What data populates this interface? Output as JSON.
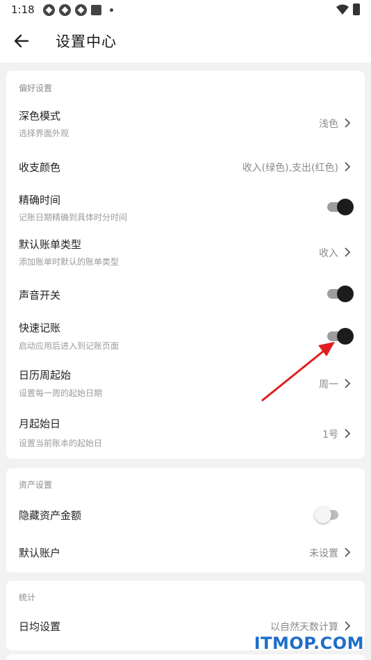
{
  "status_bar": {
    "time": "1:18"
  },
  "app_bar": {
    "title": "设置中心"
  },
  "preferences": {
    "section_label": "偏好设置",
    "dark_mode": {
      "title": "深色模式",
      "subtitle": "选择界面外观",
      "value": "浅色"
    },
    "color": {
      "title": "收支颜色",
      "value": "收入(绿色),支出(红色)"
    },
    "precise_time": {
      "title": "精确时间",
      "subtitle": "记账日期精确到具体时分时间",
      "enabled": true
    },
    "default_type": {
      "title": "默认账单类型",
      "subtitle": "添加账单时默认的账单类型",
      "value": "收入"
    },
    "sound": {
      "title": "声音开关",
      "enabled": true
    },
    "quick_entry": {
      "title": "快速记账",
      "subtitle": "启动应用后进入到记账页面",
      "enabled": true
    },
    "week_start": {
      "title": "日历周起始",
      "subtitle": "设置每一周的起始日期",
      "value": "周一"
    },
    "month_start": {
      "title": "月起始日",
      "subtitle": "设置当前账本的起始日",
      "value": "1号"
    }
  },
  "assets": {
    "section_label": "资产设置",
    "hide_amount": {
      "title": "隐藏资产金额",
      "enabled": false
    },
    "default_account": {
      "title": "默认账户",
      "value": "未设置"
    }
  },
  "stats": {
    "section_label": "统计",
    "daily_avg": {
      "title": "日均设置",
      "value": "以自然天数计算"
    }
  },
  "watermark": "ITMOP.COM",
  "colors": {
    "toggle_on": "#1c1c1c",
    "arrow": "#e02020",
    "watermark": "#1e6fc9"
  }
}
